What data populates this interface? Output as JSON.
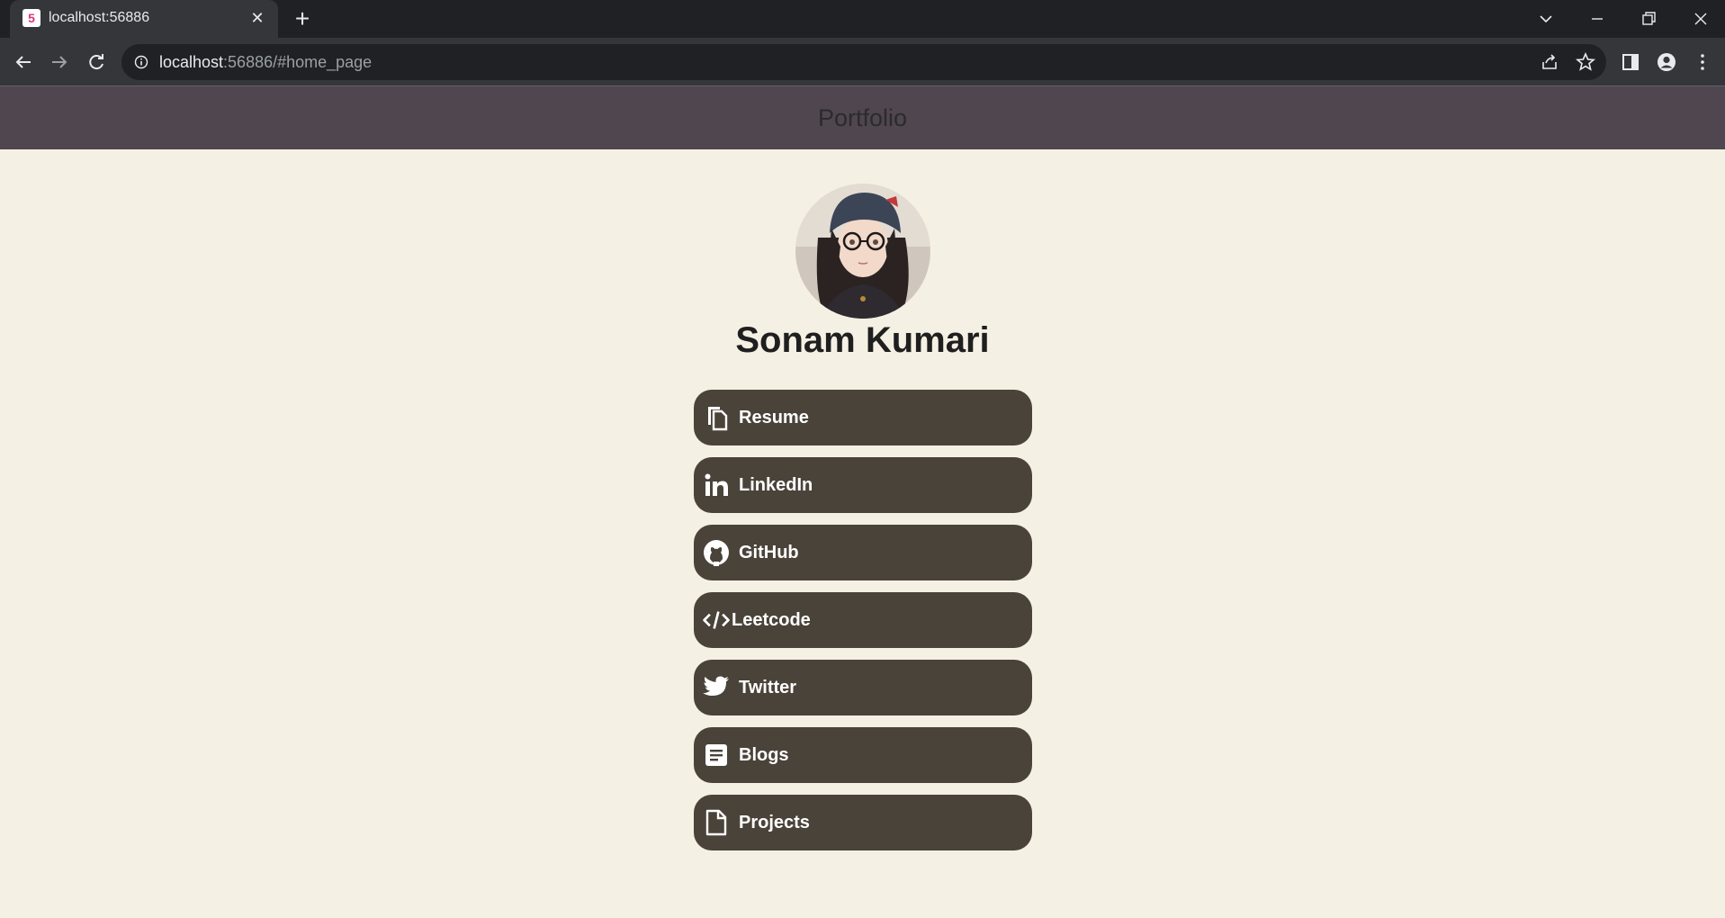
{
  "browser": {
    "tab_title": "localhost:56886",
    "favicon_glyph": "5",
    "url_host": "localhost",
    "url_rest": ":56886/#home_page"
  },
  "header": {
    "title": "Portfolio"
  },
  "profile": {
    "name": "Sonam Kumari"
  },
  "links": [
    {
      "label": "Resume",
      "icon": "copy-icon"
    },
    {
      "label": "LinkedIn",
      "icon": "linkedin-icon"
    },
    {
      "label": "GitHub",
      "icon": "github-icon"
    },
    {
      "label": "Leetcode",
      "icon": "code-icon"
    },
    {
      "label": "Twitter",
      "icon": "twitter-icon"
    },
    {
      "label": "Blogs",
      "icon": "article-icon"
    },
    {
      "label": "Projects",
      "icon": "file-icon"
    }
  ],
  "colors": {
    "page_bg": "#f5f0e4",
    "header_bg": "#4f4650",
    "button_bg": "#4a433a",
    "button_text": "#ffffff"
  }
}
